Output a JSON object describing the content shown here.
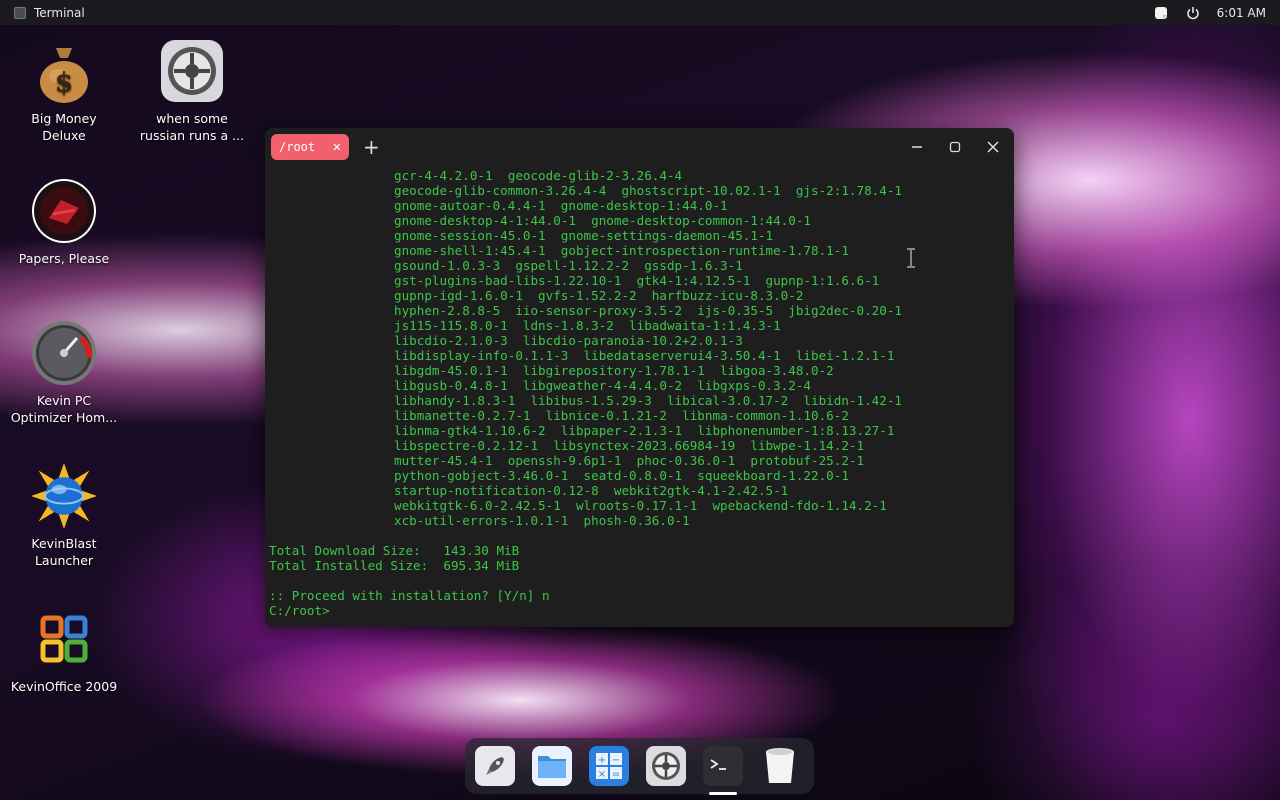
{
  "topbar": {
    "app_title": "Terminal",
    "clock": "6:01 AM",
    "icons": [
      "notes-icon",
      "power-icon"
    ]
  },
  "desktop": {
    "icons": [
      {
        "label_line1": "Big Money",
        "label_line2": "Deluxe",
        "icon": "money-bag-icon"
      },
      {
        "label_line1": "when some",
        "label_line2": "russian runs a ...",
        "icon": "settings-gear-icon"
      },
      {
        "label_line1": "Papers, Please",
        "label_line2": "",
        "icon": "papers-please-icon"
      },
      {
        "label_line1": "Kevin PC",
        "label_line2": "Optimizer Hom...",
        "icon": "speedometer-icon"
      },
      {
        "label_line1": "KevinBlast",
        "label_line2": "Launcher",
        "icon": "blast-globe-icon"
      },
      {
        "label_line1": "KevinOffice 2009",
        "label_line2": "",
        "icon": "office-logo-icon"
      }
    ]
  },
  "terminal": {
    "tab_label": "/root",
    "packages": [
      "gcr-4-4.2.0-1  geocode-glib-2-3.26.4-4",
      "geocode-glib-common-3.26.4-4  ghostscript-10.02.1-1  gjs-2:1.78.4-1",
      "gnome-autoar-0.4.4-1  gnome-desktop-1:44.0-1",
      "gnome-desktop-4-1:44.0-1  gnome-desktop-common-1:44.0-1",
      "gnome-session-45.0-1  gnome-settings-daemon-45.1-1",
      "gnome-shell-1:45.4-1  gobject-introspection-runtime-1.78.1-1",
      "gsound-1.0.3-3  gspell-1.12.2-2  gssdp-1.6.3-1",
      "gst-plugins-bad-libs-1.22.10-1  gtk4-1:4.12.5-1  gupnp-1:1.6.6-1",
      "gupnp-igd-1.6.0-1  gvfs-1.52.2-2  harfbuzz-icu-8.3.0-2",
      "hyphen-2.8.8-5  iio-sensor-proxy-3.5-2  ijs-0.35-5  jbig2dec-0.20-1",
      "js115-115.8.0-1  ldns-1.8.3-2  libadwaita-1:1.4.3-1",
      "libcdio-2.1.0-3  libcdio-paranoia-10.2+2.0.1-3",
      "libdisplay-info-0.1.1-3  libedataserverui4-3.50.4-1  libei-1.2.1-1",
      "libgdm-45.0.1-1  libgirepository-1.78.1-1  libgoa-3.48.0-2",
      "libgusb-0.4.8-1  libgweather-4-4.4.0-2  libgxps-0.3.2-4",
      "libhandy-1.8.3-1  libibus-1.5.29-3  libical-3.0.17-2  libidn-1.42-1",
      "libmanette-0.2.7-1  libnice-0.1.21-2  libnma-common-1.10.6-2",
      "libnma-gtk4-1.10.6-2  libpaper-2.1.3-1  libphonenumber-1:8.13.27-1",
      "libspectre-0.2.12-1  libsynctex-2023.66984-19  libwpe-1.14.2-1",
      "mutter-45.4-1  openssh-9.6p1-1  phoc-0.36.0-1  protobuf-25.2-1",
      "python-gobject-3.46.0-1  seatd-0.8.0-1  squeekboard-1.22.0-1",
      "startup-notification-0.12-8  webkit2gtk-4.1-2.42.5-1",
      "webkitgtk-6.0-2.42.5-1  wlroots-0.17.1-1  wpebackend-fdo-1.14.2-1",
      "xcb-util-errors-1.0.1-1  phosh-0.36.0-1"
    ],
    "download_size": "Total Download Size:   143.30 MiB",
    "installed_size": "Total Installed Size:  695.34 MiB",
    "prompt_question": ":: Proceed with installation? [Y/n] n",
    "prompt": "C:/root>"
  },
  "dock": {
    "items": [
      "launcher-rocket-icon",
      "files-folder-icon",
      "calculator-icon",
      "settings-icon",
      "terminal-icon",
      "trash-icon"
    ]
  }
}
